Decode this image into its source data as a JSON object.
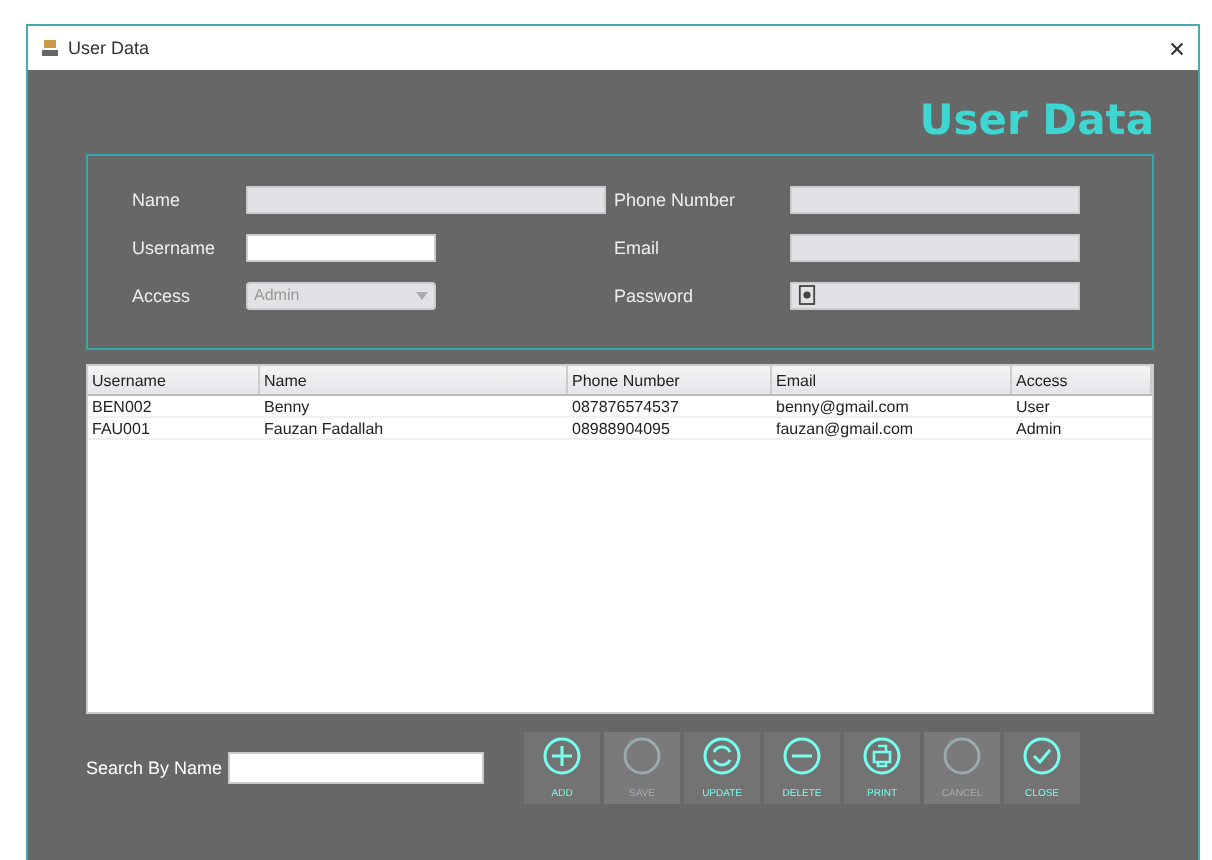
{
  "window": {
    "title": "User Data"
  },
  "heading": "User Data",
  "form": {
    "fields": [
      {
        "kind": "text",
        "label": "Name",
        "disabled": true
      },
      {
        "kind": "text",
        "label": "Phone Number",
        "disabled": true
      },
      {
        "kind": "text",
        "label": "Username",
        "disabled": false
      },
      {
        "kind": "text",
        "label": "Email",
        "disabled": true
      },
      {
        "kind": "select",
        "label": "Access",
        "value": "Admin",
        "disabled": true
      },
      {
        "kind": "password",
        "label": "Password",
        "disabled": true
      }
    ]
  },
  "table": {
    "columns": [
      "Username",
      "Name",
      "Phone Number",
      "Email",
      "Access"
    ],
    "rows": [
      [
        "BEN002",
        "Benny",
        "087876574537",
        "benny@gmail.com",
        "User"
      ],
      [
        "FAU001",
        "Fauzan Fadallah",
        "08988904095",
        "fauzan@gmail.com",
        "Admin"
      ]
    ]
  },
  "search": {
    "label": "Search By Name"
  },
  "buttons": [
    {
      "label": "ADD",
      "disabled": false
    },
    {
      "label": "SAVE",
      "disabled": true
    },
    {
      "label": "UPDATE",
      "disabled": false
    },
    {
      "label": "DELETE",
      "disabled": false
    },
    {
      "label": "PRINT",
      "disabled": false
    },
    {
      "label": "CANCEL",
      "disabled": true
    },
    {
      "label": "CLOSE",
      "disabled": false
    }
  ]
}
